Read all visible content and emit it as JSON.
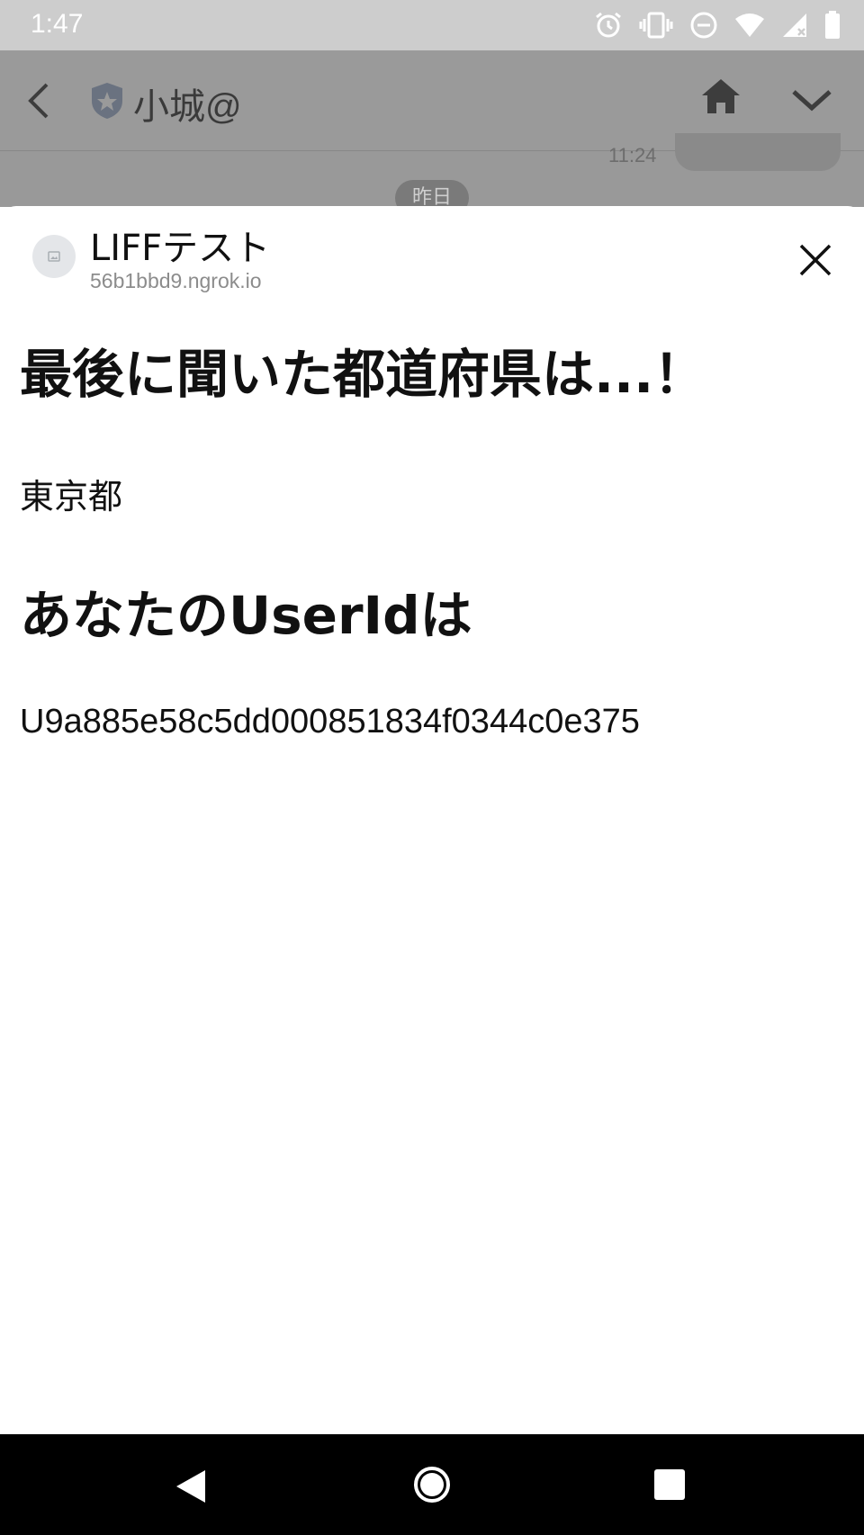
{
  "status_bar": {
    "time": "1:47",
    "icons": [
      "alarm-icon",
      "vibrate-icon",
      "dnd-icon",
      "wifi-icon",
      "signal-icon",
      "battery-icon"
    ]
  },
  "chat_header": {
    "title": "小城@",
    "icons": [
      "back-chevron-icon",
      "shield-star-icon",
      "home-icon",
      "chevron-down-icon"
    ]
  },
  "chat_background": {
    "time": "11:24",
    "date_label": "昨日"
  },
  "liff": {
    "title": "LIFFテスト",
    "url": "56b1bbd9.ngrok.io",
    "close_icon": "close-icon"
  },
  "content": {
    "heading1": "最後に聞いた都道府県は...！",
    "prefecture": "東京都",
    "heading2": "あなたのUserIdは",
    "user_id": "U9a885e58c5dd000851834f0344c0e375"
  },
  "nav_bar": {
    "icons": [
      "nav-back-icon",
      "nav-home-icon",
      "nav-recents-icon"
    ]
  }
}
